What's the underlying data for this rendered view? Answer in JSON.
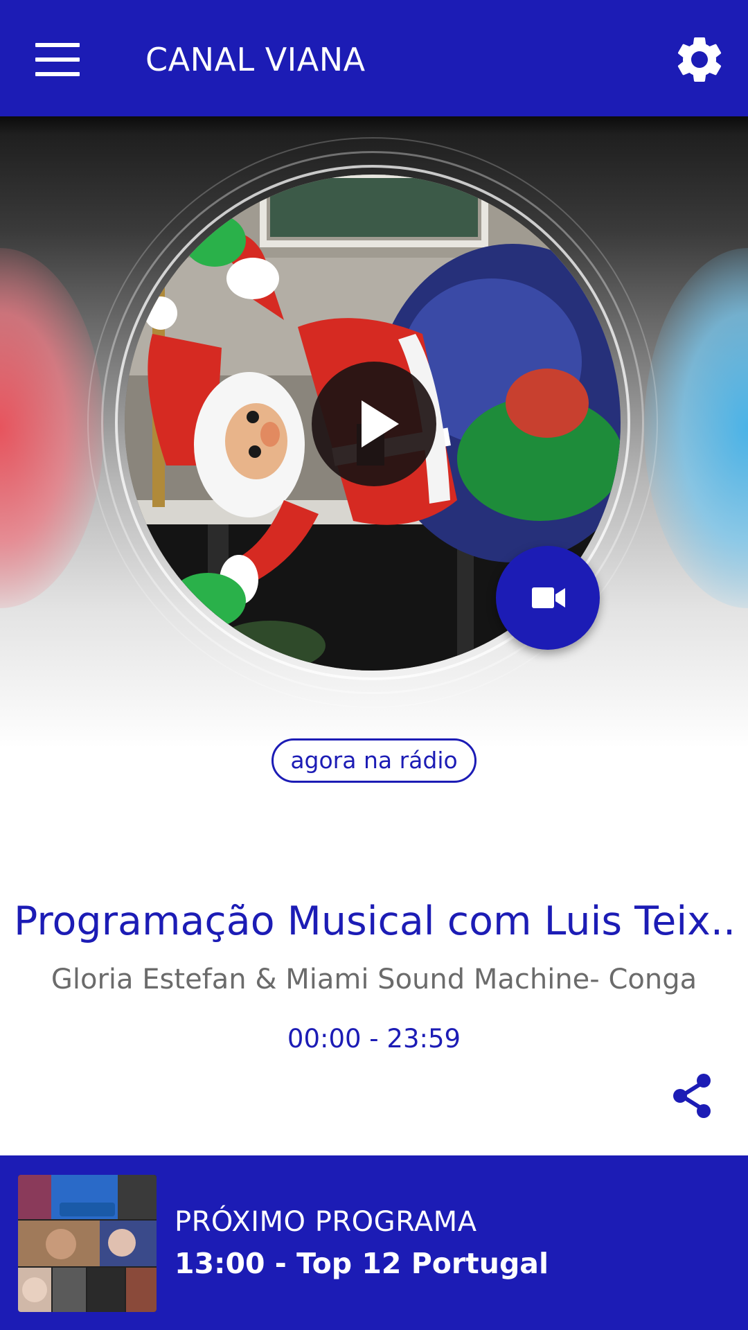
{
  "header": {
    "title": "CANAL VIANA",
    "menu_icon": "hamburger-menu-icon",
    "settings_icon": "gear-icon"
  },
  "player": {
    "cover_description_icon": "santa-inflatable-cover",
    "play_icon": "play-icon",
    "video_icon": "video-camera-icon",
    "now_label": "agora na rádio"
  },
  "program": {
    "title": "Programação Musical com Luis Teix...",
    "song": "Gloria Estefan & Miami Sound Machine- Conga",
    "time": "00:00 - 23:59",
    "share_icon": "share-icon"
  },
  "next": {
    "label": "PRÓXIMO PROGRAMA",
    "program": "13:00 - Top 12 Portugal",
    "thumb_icon": "program-collage-thumbnail"
  },
  "colors": {
    "primary": "#1c1cb5",
    "text_secondary": "#6b6b6b",
    "white": "#ffffff"
  }
}
